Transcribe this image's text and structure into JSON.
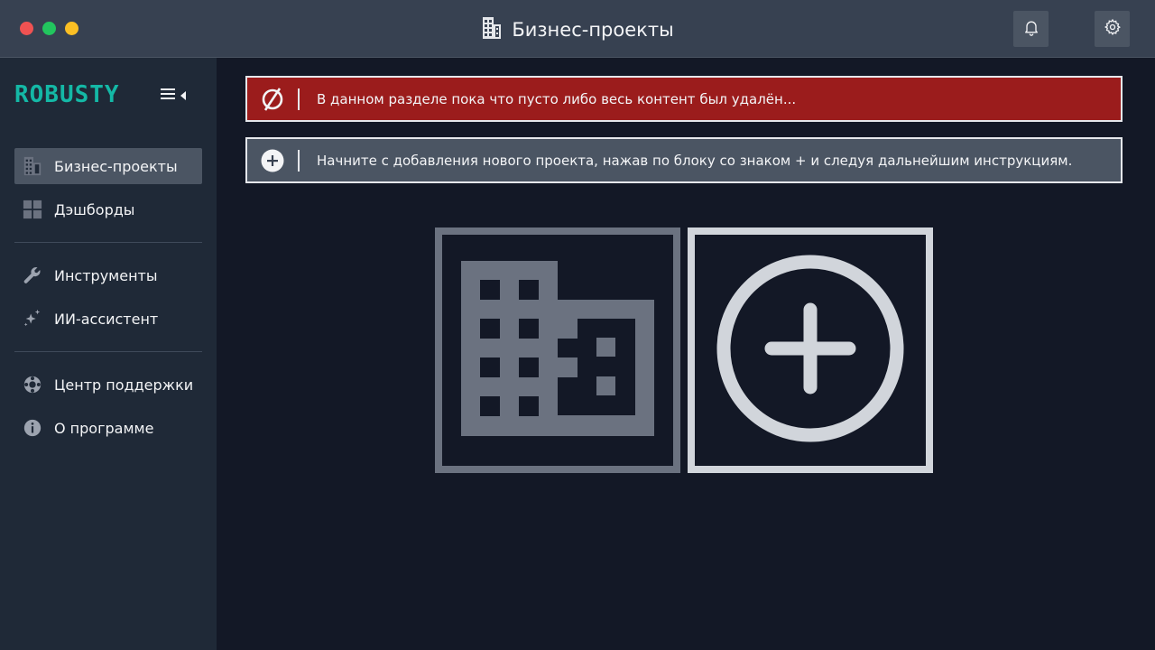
{
  "window": {
    "title": "Бизнес-проекты"
  },
  "brand": {
    "logo_text": "ROBUSTY",
    "accent_color": "#14b8a6"
  },
  "sidebar": {
    "items": [
      {
        "label": "Бизнес-проекты",
        "icon": "building-icon",
        "active": true
      },
      {
        "label": "Дэшборды",
        "icon": "dashboard-grid-icon",
        "active": false
      },
      {
        "label": "Инструменты",
        "icon": "wrench-icon",
        "active": false
      },
      {
        "label": "ИИ-ассистент",
        "icon": "sparkles-icon",
        "active": false
      },
      {
        "label": "Центр поддержки",
        "icon": "lifebuoy-icon",
        "active": false
      },
      {
        "label": "О программе",
        "icon": "info-icon",
        "active": false
      }
    ]
  },
  "alerts": {
    "empty": {
      "text": "В данном разделе пока что пусто либо весь контент был удалён...",
      "icon": "empty-set-icon",
      "color": "#9b1c1c"
    },
    "hint": {
      "text": "Начните с добавления нового проекта, нажав по блоку со знаком + и следуя дальнейшим инструкциям.",
      "icon": "plus-circle-icon",
      "color": "#4b5563"
    }
  },
  "tiles": {
    "building_icon": "building-icon",
    "add_icon": "plus-circle-icon"
  }
}
